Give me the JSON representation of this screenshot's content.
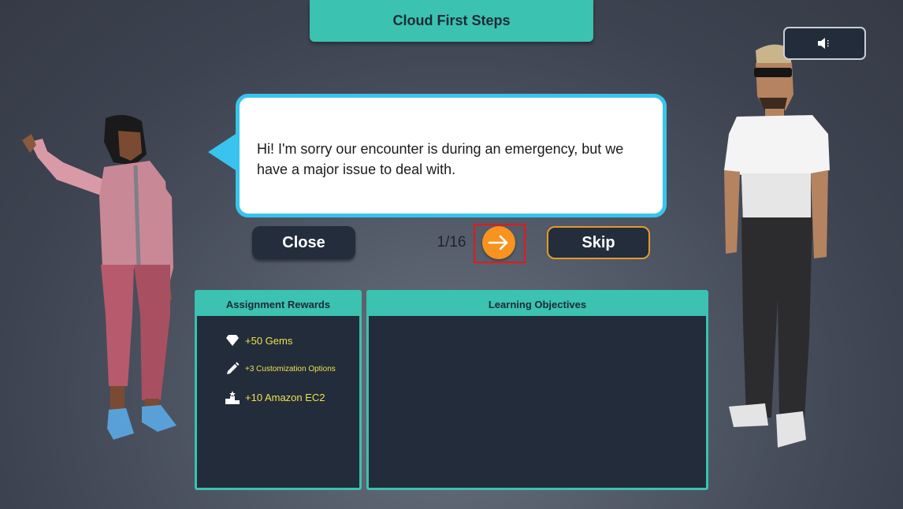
{
  "header": {
    "title": "Cloud First Steps"
  },
  "dialog": {
    "message": "Hi! I'm sorry our encounter is during an emergency, but we have a major issue to deal with.",
    "close_label": "Close",
    "counter": "1/16",
    "skip_label": "Skip"
  },
  "rewards": {
    "title": "Assignment Rewards",
    "items": [
      {
        "icon": "gem-icon",
        "label": "+50 Gems"
      },
      {
        "icon": "pencil-icon",
        "label": "+3 Customization Options"
      },
      {
        "icon": "podium-icon",
        "label": "+10 Amazon EC2"
      }
    ]
  },
  "objectives": {
    "title": "Learning Objectives"
  },
  "colors": {
    "accent": "#3bc2b0",
    "bubble_border": "#38c4ee",
    "next_button": "#f7931e",
    "reward_text": "#f0e04a",
    "panel_bg": "#222c3b"
  }
}
